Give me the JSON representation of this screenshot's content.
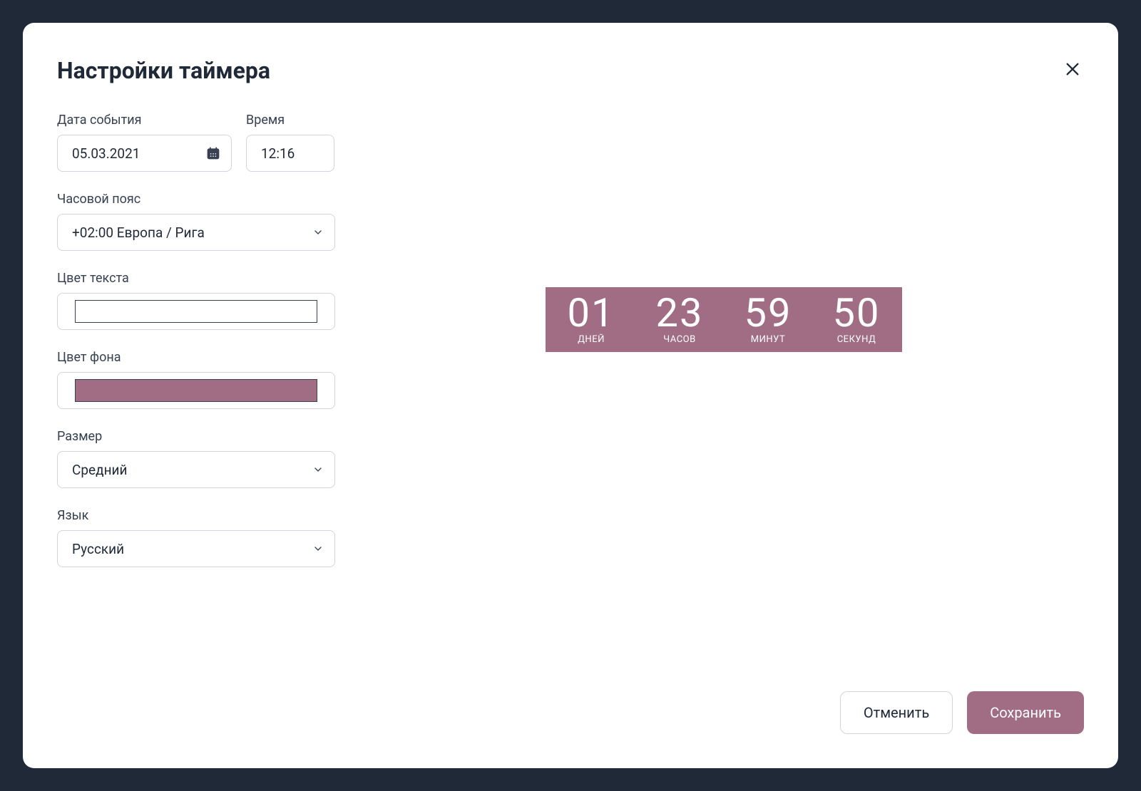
{
  "modal": {
    "title": "Настройки таймера"
  },
  "form": {
    "date_label": "Дата события",
    "date_value": "05.03.2021",
    "time_label": "Время",
    "time_value": "12:16",
    "timezone_label": "Часовой пояс",
    "timezone_value": "+02:00 Европа / Рига",
    "text_color_label": "Цвет текста",
    "text_color_value": "#ffffff",
    "bg_color_label": "Цвет фона",
    "bg_color_value": "#A06D85",
    "size_label": "Размер",
    "size_value": "Средний",
    "language_label": "Язык",
    "language_value": "Русский"
  },
  "preview": {
    "days_value": "01",
    "days_label": "ДНЕЙ",
    "hours_value": "23",
    "hours_label": "ЧАСОВ",
    "minutes_value": "59",
    "minutes_label": "МИНУТ",
    "seconds_value": "50",
    "seconds_label": "СЕКУНД"
  },
  "footer": {
    "cancel_label": "Отменить",
    "save_label": "Сохранить"
  }
}
